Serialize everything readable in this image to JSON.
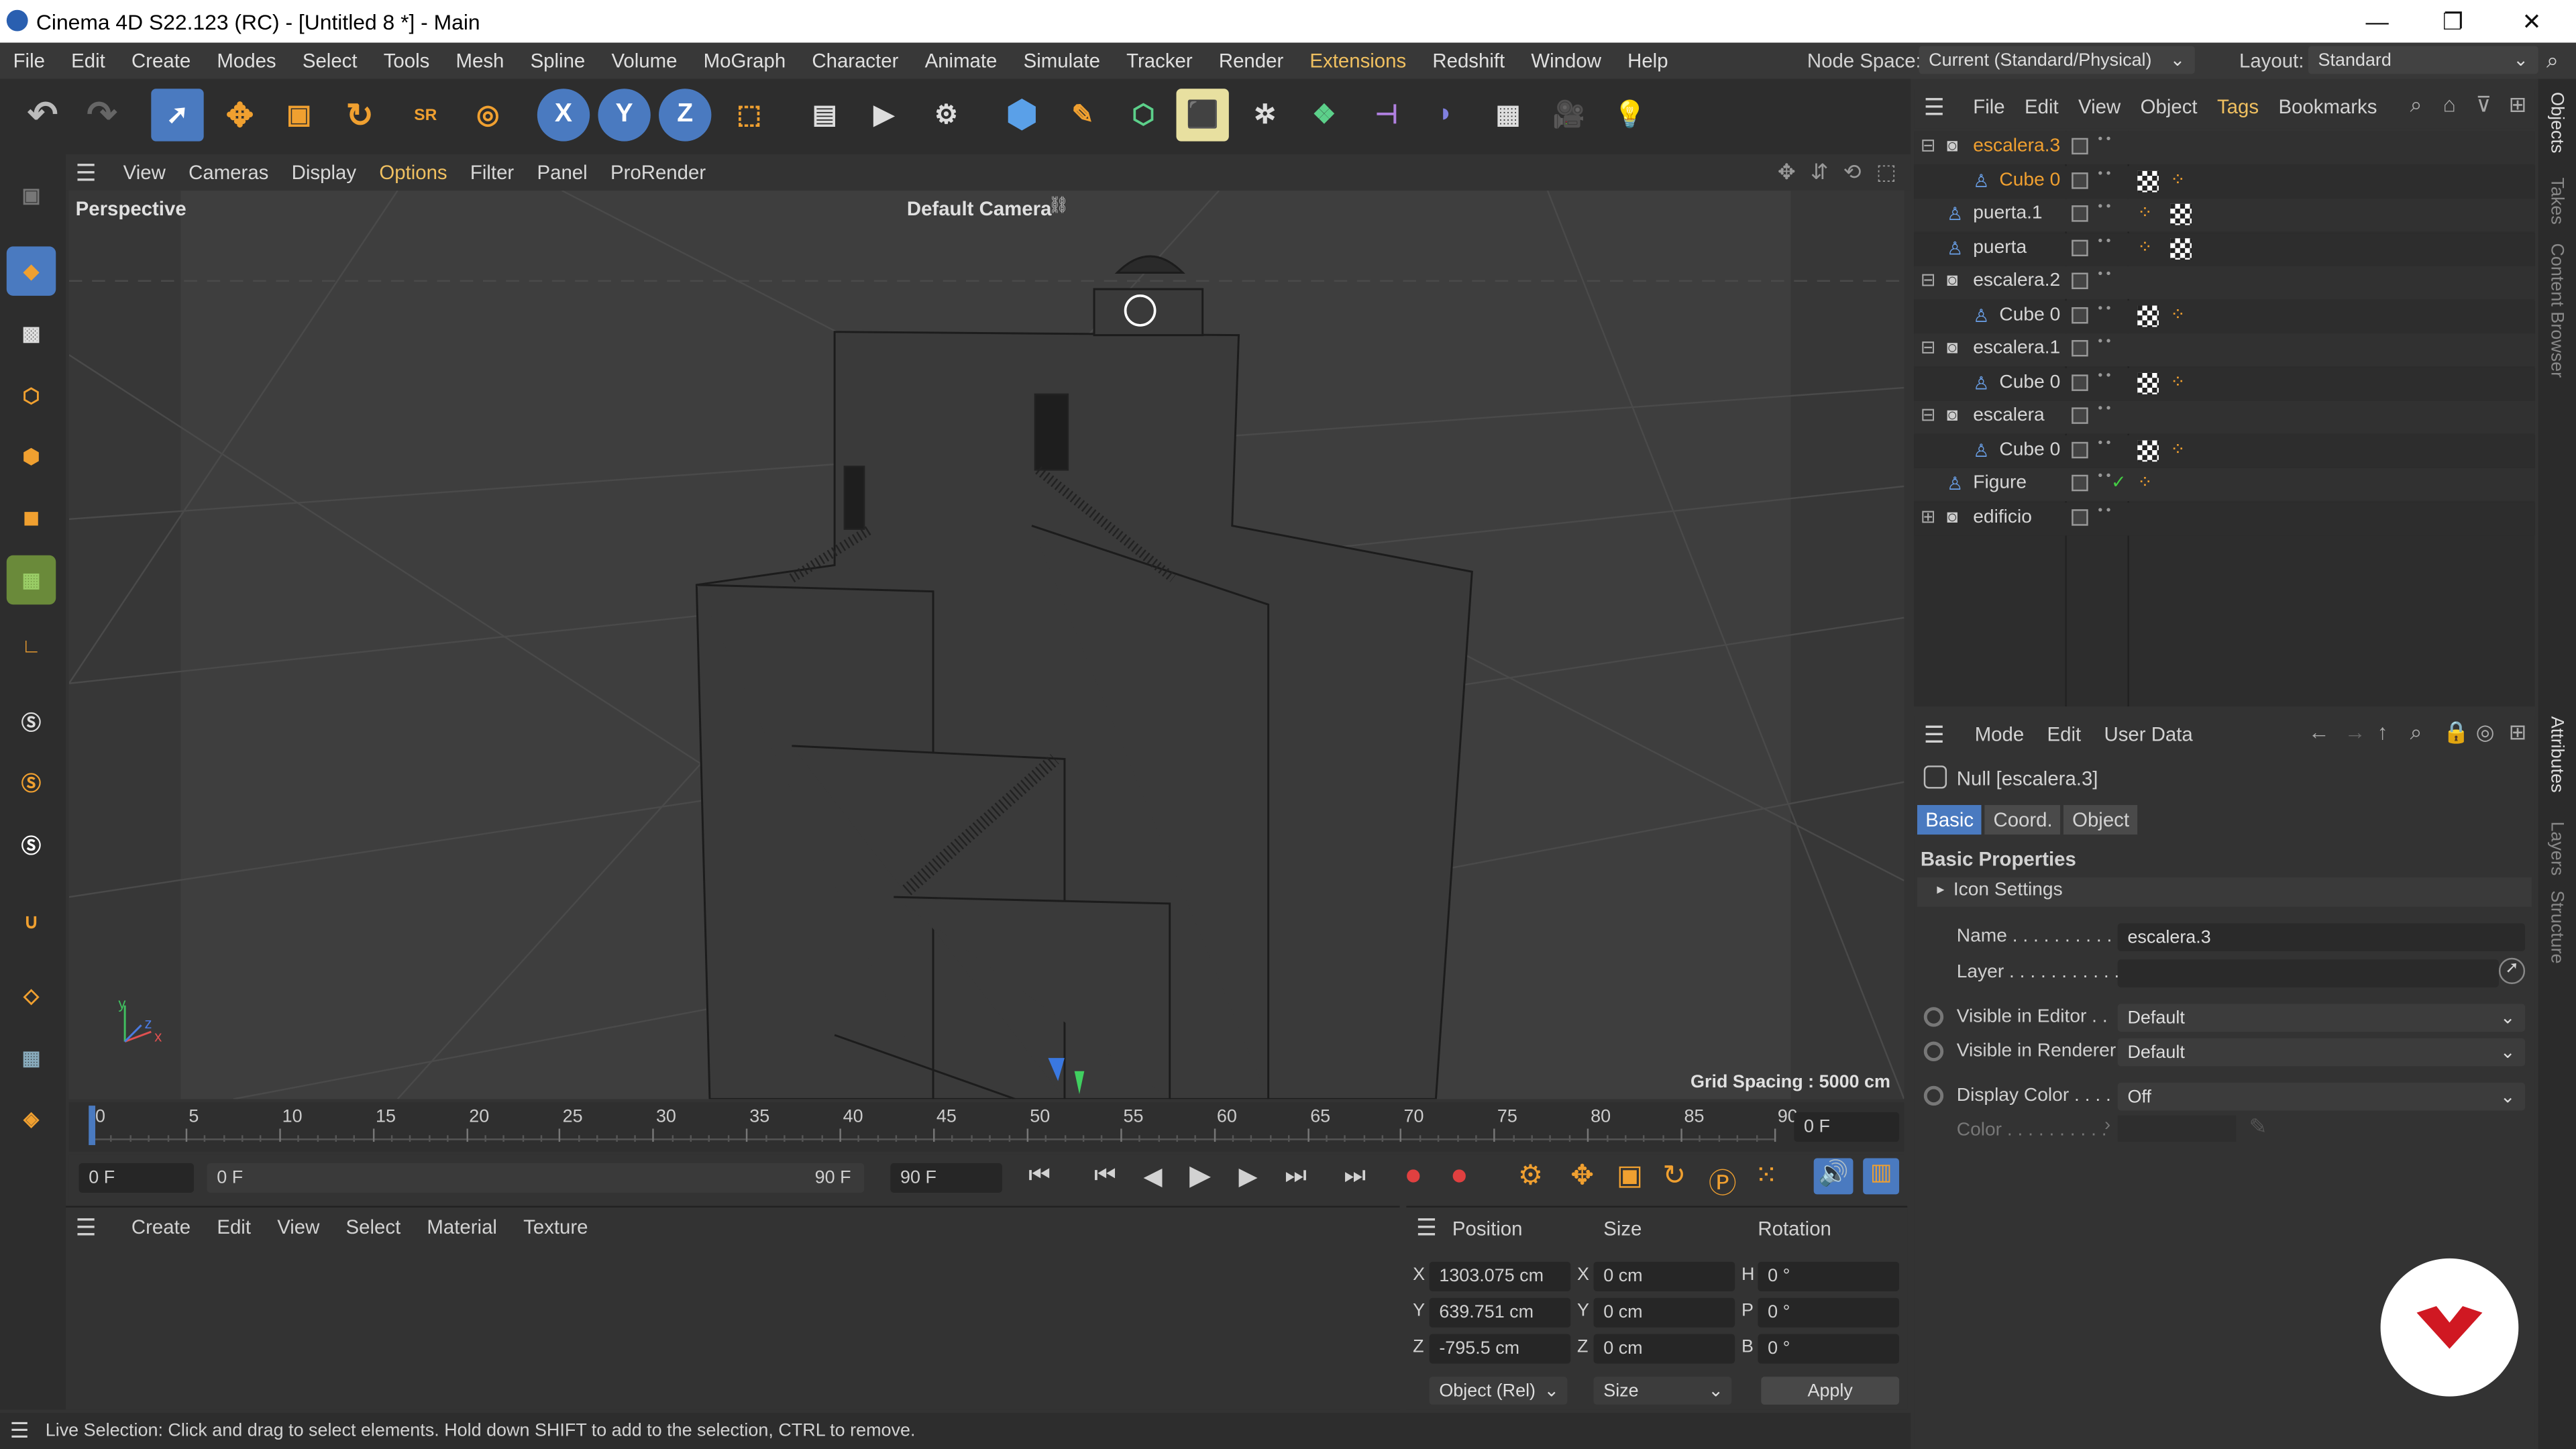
{
  "window": {
    "title": "Cinema 4D S22.123 (RC) - [Untitled 8 *] - Main",
    "minimize": "—",
    "maximize": "❐",
    "close": "✕"
  },
  "menu": [
    "File",
    "Edit",
    "Create",
    "Modes",
    "Select",
    "Tools",
    "Mesh",
    "Spline",
    "Volume",
    "MoGraph",
    "Character",
    "Animate",
    "Simulate",
    "Tracker",
    "Render",
    "Extensions",
    "Redshift",
    "Window",
    "Help"
  ],
  "node_space": {
    "label": "Node Space:",
    "value": "Current (Standard/Physical)"
  },
  "layout": {
    "label": "Layout:",
    "value": "Standard"
  },
  "toolbar": {
    "x": "X",
    "y": "Y",
    "z": "Z"
  },
  "viewport_menu": [
    "View",
    "Cameras",
    "Display",
    "Options",
    "Filter",
    "Panel",
    "ProRender"
  ],
  "viewport": {
    "name": "Perspective",
    "camera": "Default Camera",
    "grid": "Grid Spacing : 5000 cm",
    "axis_y": "y",
    "axis_x": "x",
    "axis_z": "z"
  },
  "timeline": {
    "ticks": [
      "0",
      "5",
      "10",
      "15",
      "20",
      "25",
      "30",
      "35",
      "40",
      "45",
      "50",
      "55",
      "60",
      "65",
      "70",
      "75",
      "80",
      "85",
      "90"
    ],
    "current": "0 F"
  },
  "transport": {
    "start": "0 F",
    "range_start": "0 F",
    "range_end": "90 F",
    "end": "90 F"
  },
  "material_menu": [
    "Create",
    "Edit",
    "View",
    "Select",
    "Material",
    "Texture"
  ],
  "coords": {
    "headers": [
      "Position",
      "Size",
      "Rotation"
    ],
    "rows": [
      {
        "axis": "X",
        "pos": "1303.075 cm",
        "saxis": "X",
        "size": "0 cm",
        "raxis": "H",
        "rot": "0 °"
      },
      {
        "axis": "Y",
        "pos": "639.751 cm",
        "saxis": "Y",
        "size": "0 cm",
        "raxis": "P",
        "rot": "0 °"
      },
      {
        "axis": "Z",
        "pos": "-795.5 cm",
        "saxis": "Z",
        "size": "0 cm",
        "raxis": "B",
        "rot": "0 °"
      }
    ],
    "mode": "Object (Rel)",
    "size_mode": "Size",
    "apply": "Apply"
  },
  "status": "Live Selection: Click and drag to select elements. Hold down SHIFT to add to the selection, CTRL to remove.",
  "objects_menu": [
    "File",
    "Edit",
    "View",
    "Object",
    "Tags",
    "Bookmarks"
  ],
  "objects": [
    {
      "name": "escalera.3",
      "indent": 0,
      "expand": "⊟",
      "sel": true
    },
    {
      "name": "Cube 0",
      "indent": 1,
      "expand": "",
      "sel": true
    },
    {
      "name": "puerta.1",
      "indent": 0,
      "expand": "",
      "sel": false
    },
    {
      "name": "puerta",
      "indent": 0,
      "expand": "",
      "sel": false
    },
    {
      "name": "escalera.2",
      "indent": 0,
      "expand": "⊟",
      "sel": false
    },
    {
      "name": "Cube 0",
      "indent": 1,
      "expand": "",
      "sel": false
    },
    {
      "name": "escalera.1",
      "indent": 0,
      "expand": "⊟",
      "sel": false
    },
    {
      "name": "Cube 0",
      "indent": 1,
      "expand": "",
      "sel": false
    },
    {
      "name": "escalera",
      "indent": 0,
      "expand": "⊟",
      "sel": false
    },
    {
      "name": "Cube 0",
      "indent": 1,
      "expand": "",
      "sel": false
    },
    {
      "name": "Figure",
      "indent": 0,
      "expand": "",
      "sel": false
    },
    {
      "name": "edificio",
      "indent": 0,
      "expand": "⊞",
      "sel": false
    }
  ],
  "attr_menu": [
    "Mode",
    "Edit",
    "User Data"
  ],
  "attr": {
    "object": "Null [escalera.3]",
    "tabs": [
      "Basic",
      "Coord.",
      "Object"
    ],
    "section": "Basic Properties",
    "icon_settings": "Icon Settings",
    "name_label": "Name . . . . . . . . . . .",
    "name_value": "escalera.3",
    "layer_label": "Layer . . . . . . . . . . .",
    "vis_editor_label": "Visible in Editor . .",
    "vis_editor": "Default",
    "vis_render_label": "Visible in Renderer",
    "vis_render": "Default",
    "display_color_label": "Display Color . . . . .",
    "display_color": "Off",
    "color_label": "Color . . . . . . . . . ."
  },
  "side_tabs": [
    "Objects",
    "Takes",
    "Content Browser",
    "Attributes",
    "Layers",
    "Structure"
  ],
  "colors": {
    "accent": "#f0a030",
    "blue_tab": "#4a7ac0",
    "selection": "#f0a030"
  }
}
